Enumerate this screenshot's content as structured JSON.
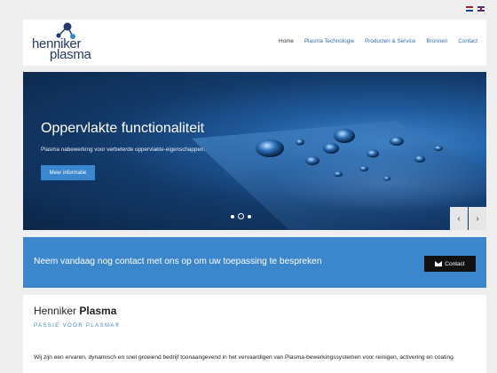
{
  "flags": {
    "nl": "dutch-flag-icon",
    "en": "english-flag-icon"
  },
  "logo": {
    "line1": "henniker",
    "line2": "plasma",
    "color": "#243a69"
  },
  "nav": {
    "items": [
      "Home",
      "Plasma Technologie",
      "Producten & Service",
      "Bronnen",
      "Contact"
    ],
    "active": "Home"
  },
  "hero": {
    "title": "Oppervlakte functionaliteit",
    "subtitle": "Plasma nabewerking voor verbeterde oppervlakte-eigenschappen.",
    "button": "Meer informatie",
    "slides": 3,
    "active_slide": 2,
    "prev": "‹",
    "next": "›"
  },
  "cta": {
    "text": "Neem vandaag nog contact met ons op om uw toepassing te bespreken",
    "button": "Contact",
    "color": "#3c86cc"
  },
  "about": {
    "title_light": "Henniker",
    "title_bold": "Plasma",
    "subtitle": "PASSIE VOOR PLASMA®",
    "text": "Wij zijn een ervaren, dynamisch en snel groeiend bedrijf toonaangevend in het vervaardigen van Plasma-bewerkingssystemen voor reinigen, activering en coating."
  }
}
